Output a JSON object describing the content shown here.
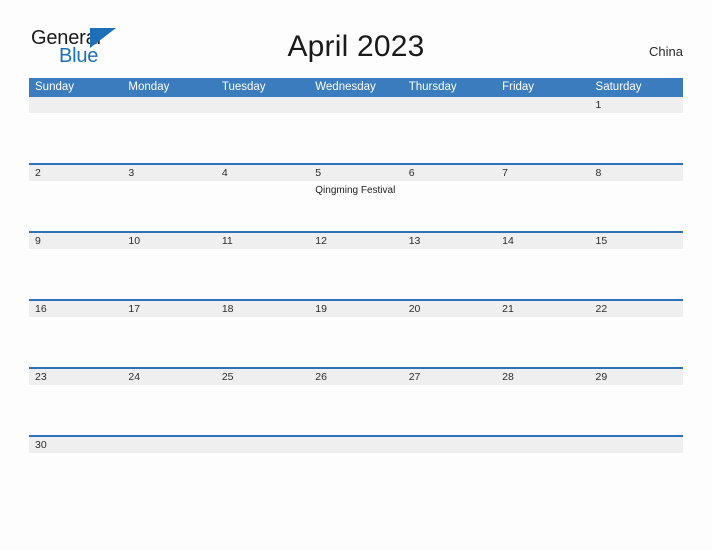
{
  "brand": {
    "name_part1": "General",
    "name_part2": "Blue",
    "flag_color": "#1d6fb8"
  },
  "header": {
    "title": "April 2023",
    "country": "China"
  },
  "colors": {
    "weekday_header_bg": "#3a7cbe",
    "week_divider": "#2f71b5",
    "day_number_bg": "#efefef",
    "page_bg": "#fdfdfd",
    "text": "#2b2b2b"
  },
  "calendar": {
    "weekdays": [
      "Sunday",
      "Monday",
      "Tuesday",
      "Wednesday",
      "Thursday",
      "Friday",
      "Saturday"
    ],
    "weeks": [
      {
        "days": [
          {
            "number": "",
            "events": []
          },
          {
            "number": "",
            "events": []
          },
          {
            "number": "",
            "events": []
          },
          {
            "number": "",
            "events": []
          },
          {
            "number": "",
            "events": []
          },
          {
            "number": "",
            "events": []
          },
          {
            "number": "1",
            "events": []
          }
        ]
      },
      {
        "days": [
          {
            "number": "2",
            "events": []
          },
          {
            "number": "3",
            "events": []
          },
          {
            "number": "4",
            "events": []
          },
          {
            "number": "5",
            "events": [
              "Qingming Festival"
            ]
          },
          {
            "number": "6",
            "events": []
          },
          {
            "number": "7",
            "events": []
          },
          {
            "number": "8",
            "events": []
          }
        ]
      },
      {
        "days": [
          {
            "number": "9",
            "events": []
          },
          {
            "number": "10",
            "events": []
          },
          {
            "number": "11",
            "events": []
          },
          {
            "number": "12",
            "events": []
          },
          {
            "number": "13",
            "events": []
          },
          {
            "number": "14",
            "events": []
          },
          {
            "number": "15",
            "events": []
          }
        ]
      },
      {
        "days": [
          {
            "number": "16",
            "events": []
          },
          {
            "number": "17",
            "events": []
          },
          {
            "number": "18",
            "events": []
          },
          {
            "number": "19",
            "events": []
          },
          {
            "number": "20",
            "events": []
          },
          {
            "number": "21",
            "events": []
          },
          {
            "number": "22",
            "events": []
          }
        ]
      },
      {
        "days": [
          {
            "number": "23",
            "events": []
          },
          {
            "number": "24",
            "events": []
          },
          {
            "number": "25",
            "events": []
          },
          {
            "number": "26",
            "events": []
          },
          {
            "number": "27",
            "events": []
          },
          {
            "number": "28",
            "events": []
          },
          {
            "number": "29",
            "events": []
          }
        ]
      },
      {
        "last": true,
        "days": [
          {
            "number": "30",
            "events": []
          },
          {
            "number": "",
            "events": []
          },
          {
            "number": "",
            "events": []
          },
          {
            "number": "",
            "events": []
          },
          {
            "number": "",
            "events": []
          },
          {
            "number": "",
            "events": []
          },
          {
            "number": "",
            "events": []
          }
        ]
      }
    ]
  }
}
